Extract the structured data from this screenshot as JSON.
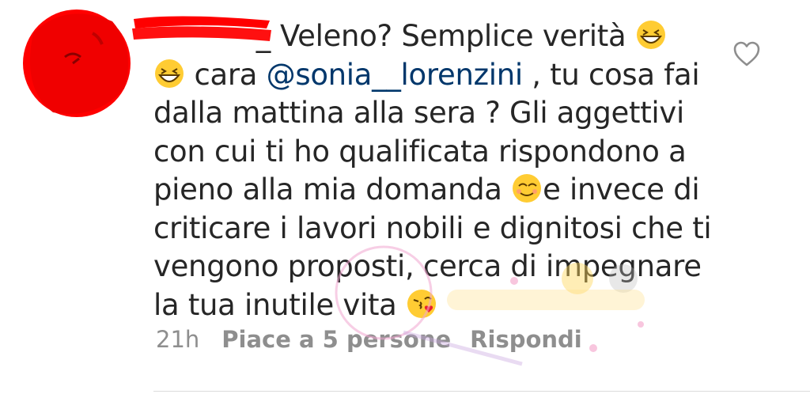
{
  "comment": {
    "username_tail": "_",
    "lines": [
      "Veleno? Semplice verità",
      "cara",
      "@sonia__lorenzini",
      ", tu cosa fai",
      "dalla mattina alla sera ? Gli aggettivi",
      "con cui ti ho qualificata rispondono a",
      "pieno alla mia domanda",
      "e invece di",
      "criticare i lavori nobili e dignitosi  che ti",
      "vengono proposti, cerca di impegnare",
      "la tua inutile vita"
    ],
    "emojis": [
      "grinning-squinting-face-emoji",
      "grinning-squinting-face-emoji",
      "smiling-face-emoji",
      "kissing-face-emoji"
    ]
  },
  "meta": {
    "time": "21h",
    "likes": "Piace a 5 persone",
    "reply": "Rispondi"
  },
  "icons": {
    "like": "heart-outline-icon"
  },
  "colors": {
    "text": "#262626",
    "mention": "#00376b",
    "meta": "#8e8e8e",
    "redaction": "#ff0000"
  }
}
